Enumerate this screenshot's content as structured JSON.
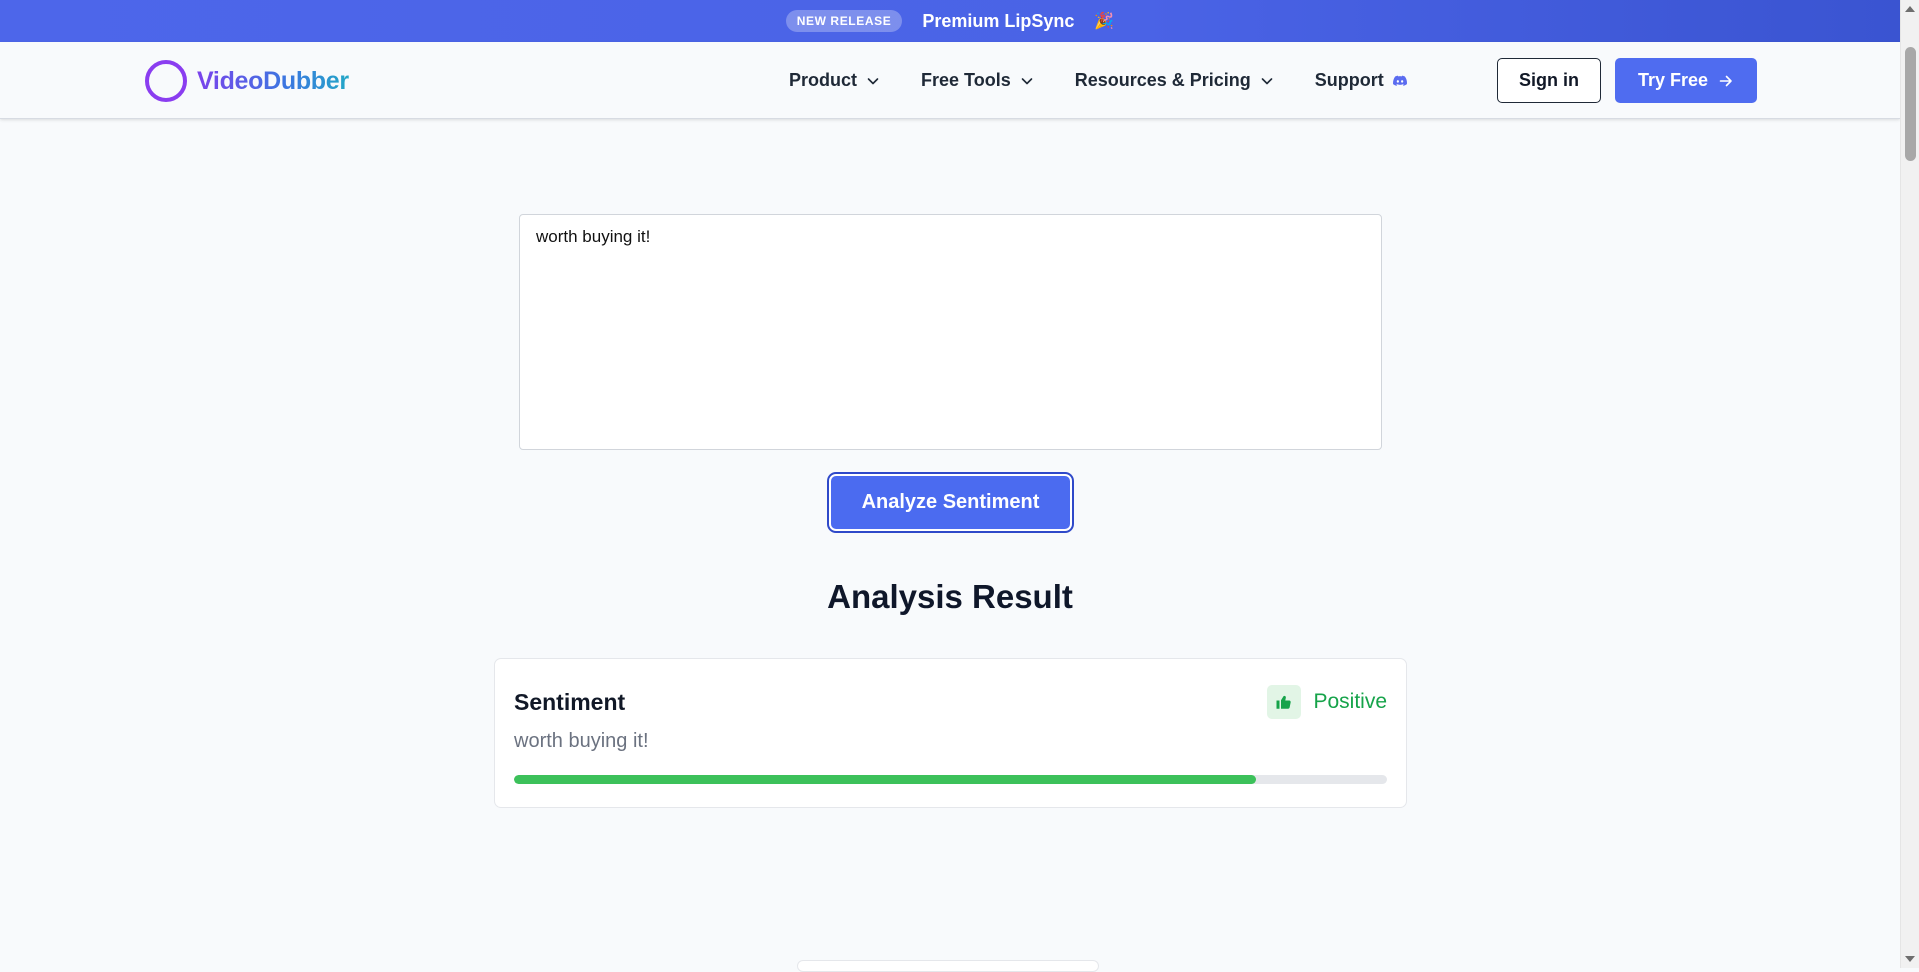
{
  "announcement": {
    "badge": "NEW RELEASE",
    "title": "Premium LipSync",
    "emoji": "🎉"
  },
  "header": {
    "brand": "VideoDubber",
    "nav": [
      {
        "label": "Product",
        "icon": "chevron-down-icon"
      },
      {
        "label": "Free Tools",
        "icon": "chevron-down-icon"
      },
      {
        "label": "Resources & Pricing",
        "icon": "chevron-down-icon"
      },
      {
        "label": "Support",
        "icon": "discord-icon"
      }
    ],
    "signin_label": "Sign in",
    "tryfree_label": "Try Free"
  },
  "main": {
    "input_value": "worth buying it!",
    "analyze_label": "Analyze Sentiment",
    "result_heading": "Analysis Result",
    "result": {
      "label": "Sentiment",
      "text": "worth buying it!",
      "sentiment": "Positive",
      "sentiment_icon": "thumbs-up-icon",
      "score_fraction": 0.85
    }
  },
  "colors": {
    "accent": "#4f6cf0",
    "positive": "#16a34a",
    "progress": "#3cc15a",
    "brand_purple": "#8a3df0"
  }
}
